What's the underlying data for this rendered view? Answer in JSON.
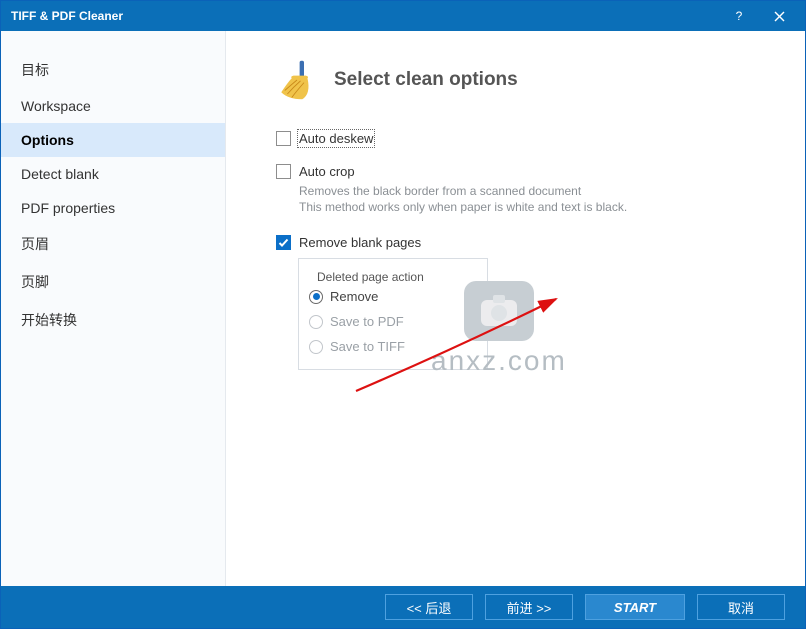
{
  "window": {
    "title": "TIFF & PDF Cleaner"
  },
  "sidebar": {
    "items": [
      {
        "label": "目标"
      },
      {
        "label": "Workspace"
      },
      {
        "label": "Options"
      },
      {
        "label": "Detect blank"
      },
      {
        "label": "PDF properties"
      },
      {
        "label": "页眉"
      },
      {
        "label": "页脚"
      },
      {
        "label": "开始转换"
      }
    ],
    "active_index": 2
  },
  "page": {
    "title": "Select clean options",
    "auto_deskew": {
      "label": "Auto deskew",
      "checked": false
    },
    "auto_crop": {
      "label": "Auto crop",
      "checked": false,
      "hint_line1": "Removes the black border from a scanned document",
      "hint_line2": "This method works only when paper is white and text is black."
    },
    "remove_blank": {
      "label": "Remove blank pages",
      "checked": true
    },
    "deleted_action": {
      "legend": "Deleted page action",
      "options": [
        {
          "label": "Remove",
          "selected": true
        },
        {
          "label": "Save to PDF",
          "selected": false
        },
        {
          "label": "Save to TIFF",
          "selected": false
        }
      ]
    }
  },
  "footer": {
    "back": "<<  后退",
    "next": "前进  >>",
    "start": "START",
    "cancel": "取消"
  },
  "watermark": {
    "text": "anxz.com"
  }
}
